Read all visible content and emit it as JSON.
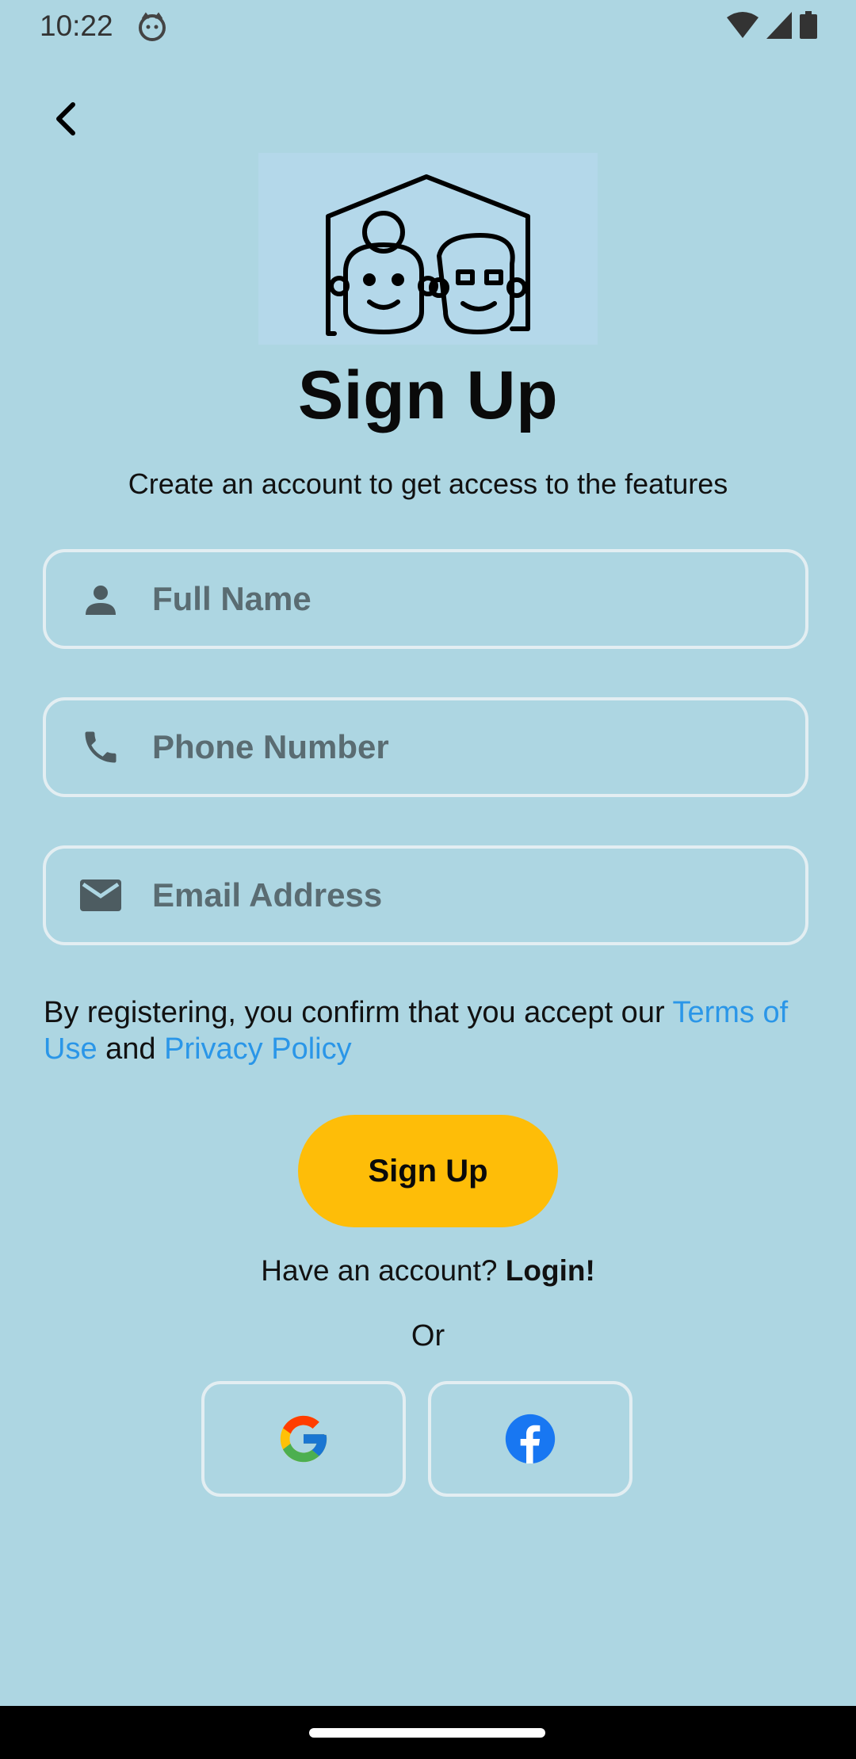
{
  "status_bar": {
    "time": "10:22"
  },
  "screen": {
    "title": "Sign Up",
    "subtitle": "Create an account to get access to the features"
  },
  "form": {
    "full_name_placeholder": "Full Name",
    "phone_placeholder": "Phone Number",
    "email_placeholder": "Email Address"
  },
  "terms": {
    "prefix": "By registering, you confirm that you accept our ",
    "terms_link": "Terms of Use",
    "middle": " and ",
    "privacy_link": "Privacy Policy"
  },
  "actions": {
    "signup_label": "Sign Up",
    "have_account": "Have an account? ",
    "login_label": "Login!",
    "or_label": "Or"
  },
  "icons": {
    "back": "back-arrow-icon",
    "person": "person-icon",
    "phone": "phone-icon",
    "email": "mail-icon",
    "google": "google-icon",
    "facebook": "facebook-icon"
  },
  "colors": {
    "background": "#ADD6E2",
    "accent_button": "#FEBD08",
    "link": "#2A96E8",
    "field_border": "#E3EEF2"
  }
}
